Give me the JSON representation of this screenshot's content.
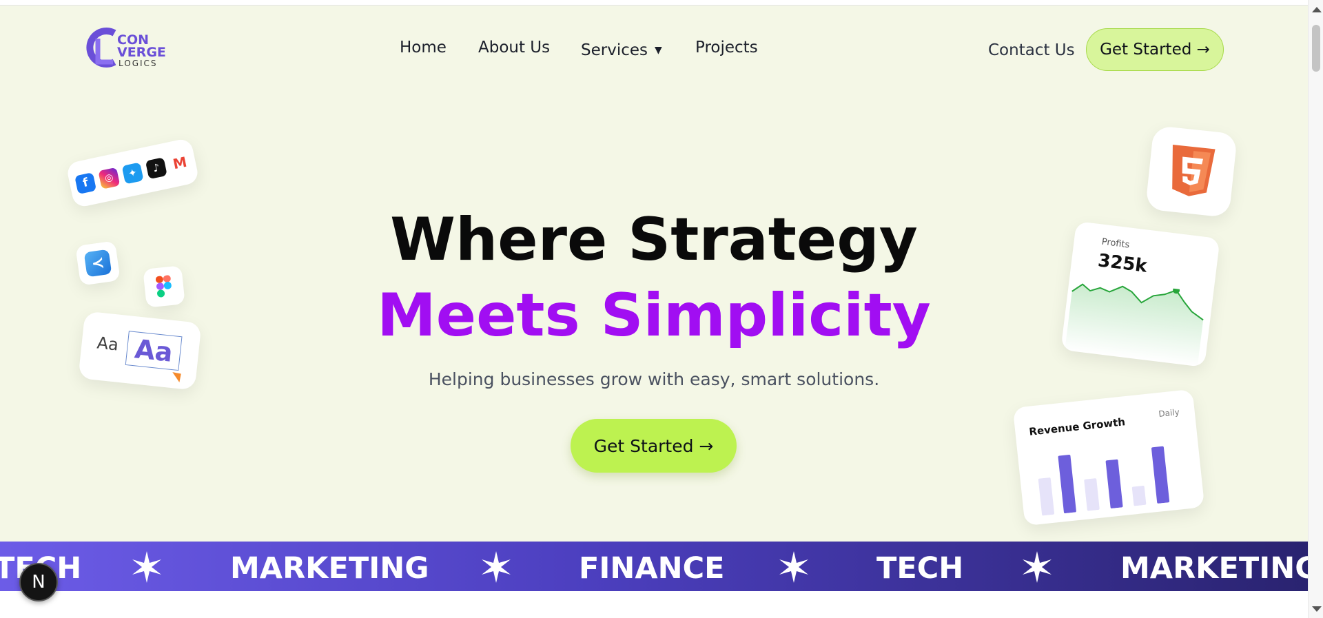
{
  "nav": {
    "logo_text_1": "CON",
    "logo_text_2": "VERGE",
    "logo_text_3": "LOGICS",
    "home": "Home",
    "about": "About Us",
    "services": "Services",
    "services_caret": "▼",
    "projects": "Projects",
    "contact": "Contact Us",
    "cta": "Get Started →"
  },
  "hero": {
    "headline_line1": "Where Strategy",
    "headline_line2": "Meets Simplicity",
    "subtitle": "Helping businesses grow with easy, smart solutions.",
    "cta": "Get Started →"
  },
  "cards": {
    "social_icons": [
      "facebook-icon",
      "instagram-icon",
      "twitter-icon",
      "tiktok-icon",
      "gmail-icon"
    ],
    "font_small": "Aa",
    "font_big": "Aa",
    "profits_label": "Profits",
    "profits_value": "325k",
    "revenue_title": "Revenue Growth",
    "revenue_period": "Daily"
  },
  "marquee": {
    "items": [
      "TECH",
      "MARKETING",
      "FINANCE",
      "TECH",
      "MARKETING"
    ]
  },
  "badge": {
    "letter": "N"
  },
  "colors": {
    "hero_bg": "#f4f7e6",
    "headline_accent": "#a10ef2",
    "cta_green": "#bdf250",
    "marquee_start": "#6c5ce7",
    "marquee_end": "#2a2370"
  }
}
